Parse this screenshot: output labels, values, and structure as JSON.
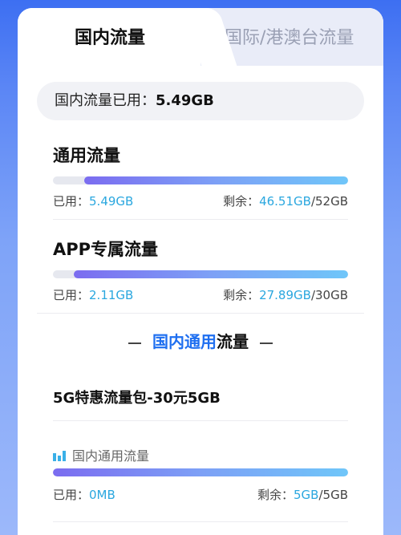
{
  "tabs": {
    "active_label": "国内流量",
    "inactive_label": "国际/港澳台流量"
  },
  "summary": {
    "label": "国内流量已用：",
    "value": "5.49GB"
  },
  "general": {
    "title": "通用流量",
    "used_label": "已用：",
    "used_value": "5.49GB",
    "remain_label": "剩余：",
    "remain_value": "46.51GB",
    "total": "/52GB",
    "used_fraction": 0.106
  },
  "app": {
    "title": "APP专属流量",
    "used_label": "已用：",
    "used_value": "2.11GB",
    "remain_label": "剩余：",
    "remain_value": "27.89GB",
    "total": "/30GB",
    "used_fraction": 0.07
  },
  "mid_heading": {
    "highlight": "国内通用",
    "rest": "流量"
  },
  "package": {
    "title": "5G特惠流量包-30元5GB",
    "sub_label": "国内通用流量",
    "sub_icon": "bar-chart-icon",
    "used_label": "已用：",
    "used_value": "0MB",
    "remain_label": "剩余：",
    "remain_value": "5GB",
    "total": "/5GB",
    "used_fraction": 0
  },
  "colors": {
    "accent_blue": "#1f6ff0",
    "value_cyan": "#2aa7df",
    "bar_start": "#7b6cf0",
    "bar_end": "#6fc6f9"
  }
}
